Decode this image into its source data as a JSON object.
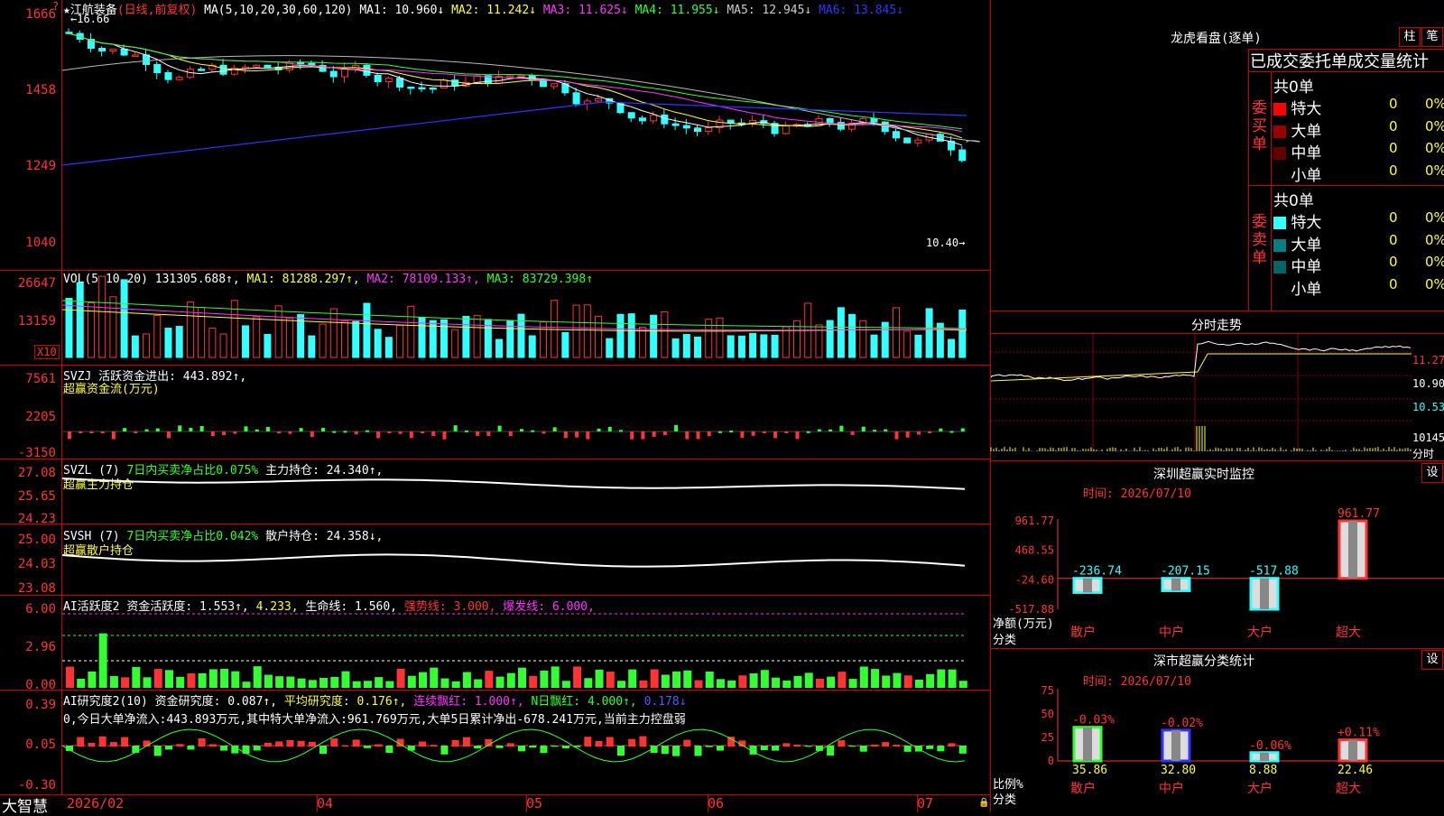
{
  "app": {
    "name": "大智慧",
    "sort_icon": "sort-icon",
    "lock_icon": "lock-icon"
  },
  "stock": {
    "title": "★江航装备",
    "mode": "(日线,前复权)",
    "top_marker": "?"
  },
  "ma": {
    "label": "MA(5,10,20,30,60,120)",
    "items": [
      {
        "name": "MA1:",
        "value": "10.960↓",
        "color": "#ffffff"
      },
      {
        "name": "MA2:",
        "value": "11.242↓",
        "color": "#ffff33"
      },
      {
        "name": "MA3:",
        "value": "11.625↓",
        "color": "#ff33ff"
      },
      {
        "name": "MA4:",
        "value": "11.955↓",
        "color": "#33ff33"
      },
      {
        "name": "MA5:",
        "value": "12.945↓",
        "color": "#cccccc"
      },
      {
        "name": "MA6:",
        "value": "13.845↓",
        "color": "#3333ff"
      }
    ]
  },
  "price_axis": [
    "1666",
    "1458",
    "1249",
    "1040"
  ],
  "price_labels": {
    "high": "16.66",
    "low": "10.40"
  },
  "vol": {
    "label": "VOL(5,10,20)",
    "value": "131305.688↑,",
    "ma1": "MA1: 81288.297↑,",
    "ma2": "MA2: 78109.133↑,",
    "ma3": "MA3: 83729.398↑",
    "axis": [
      "26647",
      "13159"
    ],
    "unit": "X10"
  },
  "svzj": {
    "label": "SVZJ  活跃资金进出: 443.892↑,",
    "sub": "超赢资金流(万元)",
    "axis": [
      "7561",
      "2205",
      "-3150"
    ]
  },
  "svzl": {
    "label": "SVZL (7)",
    "pct": "7日内买卖净占比0.075%",
    "hold": "主力持仓: 24.340↑,",
    "sub": "超赢主力持仓",
    "axis": [
      "27.08",
      "25.65",
      "24.23"
    ]
  },
  "svsh": {
    "label": "SVSH (7)",
    "pct": "7日内买卖净占比0.042%",
    "hold": "散户持仓: 24.358↓,",
    "sub": "超赢散户持仓",
    "axis": [
      "25.00",
      "24.03",
      "23.08"
    ]
  },
  "ai_act": {
    "label": "AI活跃度2",
    "v1": "资金活跃度: 1.553↑,",
    "v2": "4.233,",
    "v3": "生命线: 1.560,",
    "v4": "强势线: 3.000,",
    "v5": "爆发线: 6.000,",
    "axis": [
      "6.00",
      "2.96",
      "0.00"
    ]
  },
  "ai_res": {
    "label": "AI研究度2(10)",
    "v1": "资金研究度: 0.087↑,",
    "v2": "平均研究度: 0.176↑,",
    "v3": "连续飘红: 1.000↑,",
    "v4": "N日飘红: 4.000↑,",
    "v5": "0.178↓",
    "note": "0,今日大单净流入:443.893万元,其中特大单净流入:961.769万元,大单5日累计净出-678.241万元,当前主力控盘弱",
    "axis": [
      "0.39",
      "0.05",
      "-0.30"
    ]
  },
  "dates": [
    "2026/02",
    "04",
    "05",
    "06",
    "07"
  ],
  "right": {
    "lhkp": "龙虎看盘(逐单)",
    "btn_col": "柱",
    "btn_bi": "笔",
    "table_title": "已成交委托单成交量统计",
    "buy": {
      "side": "委买单",
      "total": "共0单",
      "rows": [
        {
          "label": "特大",
          "count": "0",
          "pct": "0%",
          "color": "#ff0000"
        },
        {
          "label": "大单",
          "count": "0",
          "pct": "0%",
          "color": "#990000"
        },
        {
          "label": "中单",
          "count": "0",
          "pct": "0%",
          "color": "#660000"
        },
        {
          "label": "小单",
          "count": "0",
          "pct": "0%",
          "color": ""
        }
      ]
    },
    "sell": {
      "side": "委卖单",
      "total": "共0单",
      "rows": [
        {
          "label": "特大",
          "count": "0",
          "pct": "0%",
          "color": "#33ffff"
        },
        {
          "label": "大单",
          "count": "0",
          "pct": "0%",
          "color": "#008080"
        },
        {
          "label": "中单",
          "count": "0",
          "pct": "0%",
          "color": "#006666"
        },
        {
          "label": "小单",
          "count": "0",
          "pct": "0%",
          "color": ""
        }
      ]
    },
    "fenshi": {
      "title": "分时走势",
      "axis": [
        "11.27",
        "10.90",
        "10.53",
        "10145"
      ],
      "unit": "分时"
    },
    "monitor": {
      "title": "深圳超赢实时监控",
      "settings": "设",
      "time": "时间: 2026/07/10",
      "axis": [
        "961.77",
        "468.55",
        "-24.60",
        "-517.88"
      ],
      "ylabel": "净额(万元)",
      "xlabel": "分类",
      "cats": [
        "散户",
        "中户",
        "大户",
        "超大"
      ],
      "labels": [
        "-236.74",
        "-207.15",
        "-517.88",
        "961.77"
      ]
    },
    "classify": {
      "title": "深市超赢分类统计",
      "settings": "设",
      "time": "时间: 2026/07/10",
      "axis": [
        "75",
        "50",
        "25",
        "0"
      ],
      "ylabel": "比例%",
      "xlabel": "分类",
      "cats": [
        "散户",
        "中户",
        "大户",
        "超大"
      ],
      "values": [
        "35.86",
        "32.80",
        "8.88",
        "22.46"
      ],
      "changes": [
        "-0.03%",
        "-0.02%",
        "-0.06%",
        "+0.11%"
      ]
    }
  },
  "chart_data": [
    {
      "type": "bar",
      "title": "深圳超赢实时监控",
      "categories": [
        "散户",
        "中户",
        "大户",
        "超大"
      ],
      "values": [
        -236.74,
        -207.15,
        -517.88,
        961.77
      ],
      "ylabel": "净额(万元)",
      "ylim": [
        -517.88,
        961.77
      ]
    },
    {
      "type": "bar",
      "title": "深市超赢分类统计",
      "categories": [
        "散户",
        "中户",
        "大户",
        "超大"
      ],
      "values": [
        35.86,
        32.8,
        8.88,
        22.46
      ],
      "ylabel": "比例%",
      "ylim": [
        0,
        75
      ]
    }
  ]
}
